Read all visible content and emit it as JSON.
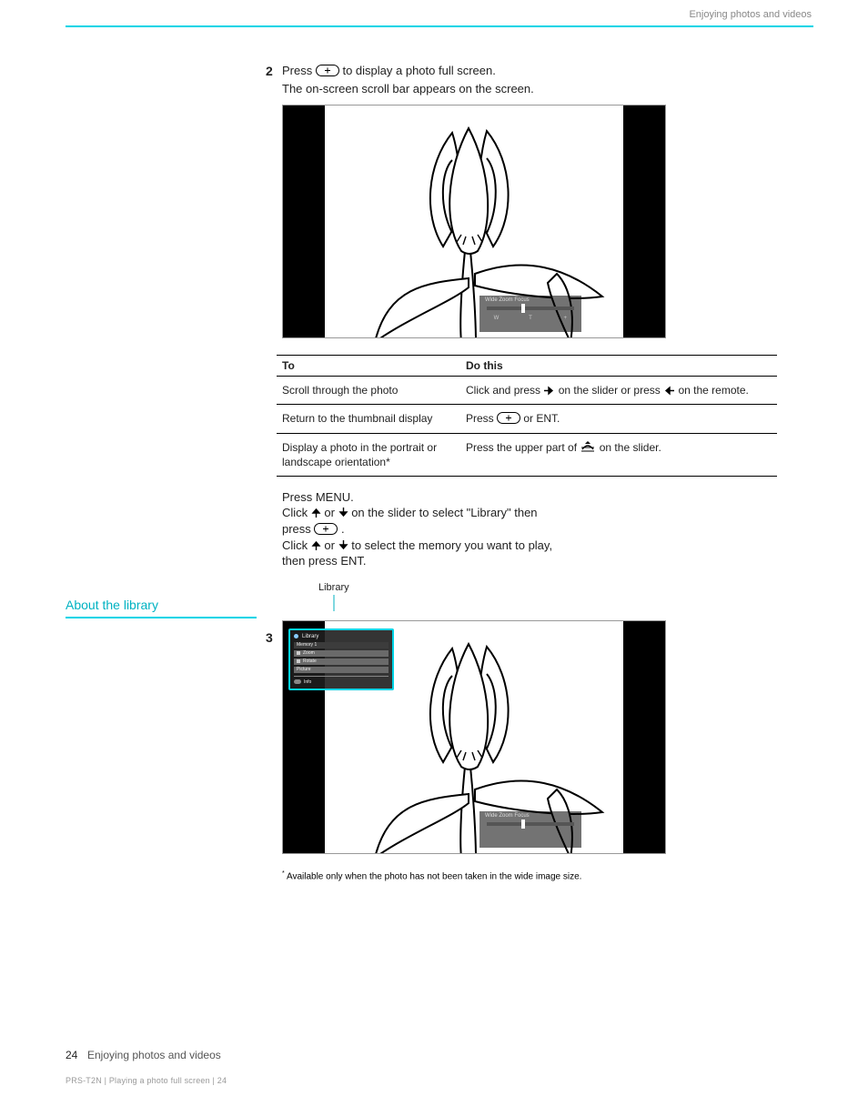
{
  "header": {
    "right_text": "Enjoying photos and videos"
  },
  "side": {
    "library_heading": "About the library"
  },
  "step2": {
    "num": "2",
    "line1_a": "Press ",
    "line1_b": " to display a photo full screen.",
    "line2": "The on-screen scroll bar appears on the screen."
  },
  "figure1": {
    "scroll_label": "Wide Zoom Focus",
    "tick_w": "W",
    "tick_t": "T",
    "tick_plus": "+"
  },
  "table": {
    "col1": "To",
    "col2": "Do this",
    "rows": [
      {
        "left": "Scroll through the photo",
        "right_a": "Click and press ",
        "right_b": " on the slider or press ",
        "right_c": " on the remote."
      },
      {
        "left": "Return to the thumbnail display",
        "right_a": "Press ",
        "right_b": " or ENT."
      },
      {
        "left": "Display a photo in the portrait or landscape orientation",
        "right_a": "Press the upper part of ",
        "right_b": " on the slider.",
        "footnote_ref": "*"
      }
    ]
  },
  "step3": {
    "num": "3",
    "text_1": "Press MENU.",
    "text_2a": "Click ",
    "text_2b": " or ",
    "text_2c": " on the slider to select \"Library\" then",
    "text_3a": "press ",
    "text_3b": ".",
    "text_4a": "Click ",
    "text_4b": " or ",
    "text_4c": " to select the memory you want to play,",
    "text_5": "then press ENT."
  },
  "library": {
    "label_above": "Library",
    "overlay_title": "Library",
    "items": [
      "Memory 1",
      "Zoom",
      "Rotate",
      "Picture"
    ],
    "last": "Info"
  },
  "figure2": {
    "scroll_label": "Wide Zoom Focus"
  },
  "footnote": {
    "marker": "*",
    "text": " Available only when the photo has not been taken in the wide image size."
  },
  "footer": {
    "page": "24",
    "section": "Enjoying photos and videos",
    "pdf": "PRS-T2N | Playing a photo full screen | 24"
  }
}
